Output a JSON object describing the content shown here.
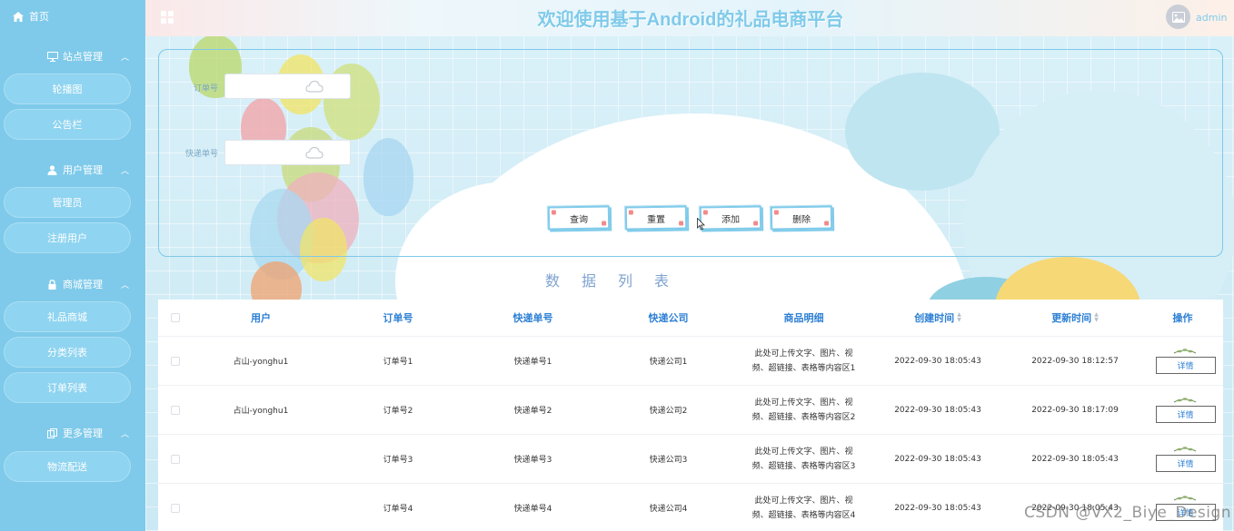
{
  "header": {
    "title": "欢迎使用基于Android的礼品电商平台",
    "user": "admin"
  },
  "sidebar": {
    "home": "首页",
    "groups": [
      {
        "label": "站点管理",
        "icon": "monitor-icon",
        "items": [
          "轮播图",
          "公告栏"
        ]
      },
      {
        "label": "用户管理",
        "icon": "user-icon",
        "items": [
          "管理员",
          "注册用户"
        ]
      },
      {
        "label": "商城管理",
        "icon": "lock-icon",
        "items": [
          "礼品商城",
          "分类列表",
          "订单列表"
        ]
      },
      {
        "label": "更多管理",
        "icon": "copy-icon",
        "items": [
          "物流配送"
        ]
      }
    ]
  },
  "search": {
    "order_label": "订单号",
    "express_label": "快递单号",
    "order_value": "",
    "express_value": "",
    "buttons": {
      "query": "查询",
      "reset": "重置",
      "add": "添加",
      "delete": "删除"
    }
  },
  "table": {
    "title": "数据列表",
    "columns": [
      "用户",
      "订单号",
      "快递单号",
      "快递公司",
      "商品明细",
      "创建时间",
      "更新时间",
      "操作"
    ],
    "detail_label": "详情",
    "rows": [
      {
        "user": "占山-yonghu1",
        "order": "订单号1",
        "express_no": "快递单号1",
        "company": "快递公司1",
        "detail_line1": "此处可上传文字、图片、视",
        "detail_line2": "频、超链接、表格等内容区1",
        "created": "2022-09-30 18:05:43",
        "updated": "2022-09-30 18:12:57"
      },
      {
        "user": "占山-yonghu1",
        "order": "订单号2",
        "express_no": "快递单号2",
        "company": "快递公司2",
        "detail_line1": "此处可上传文字、图片、视",
        "detail_line2": "频、超链接、表格等内容区2",
        "created": "2022-09-30 18:05:43",
        "updated": "2022-09-30 18:17:09"
      },
      {
        "user": "",
        "order": "订单号3",
        "express_no": "快递单号3",
        "company": "快递公司3",
        "detail_line1": "此处可上传文字、图片、视",
        "detail_line2": "频、超链接、表格等内容区3",
        "created": "2022-09-30 18:05:43",
        "updated": "2022-09-30 18:05:43"
      },
      {
        "user": "",
        "order": "订单号4",
        "express_no": "快递单号4",
        "company": "快递公司4",
        "detail_line1": "此处可上传文字、图片、视",
        "detail_line2": "频、超链接、表格等内容区4",
        "created": "2022-09-30 18:05:43",
        "updated": "2022-09-30 18:05:43"
      }
    ]
  },
  "watermark": "CSDN @VX2_Biye_Design",
  "colors": {
    "accent": "#7fcaea",
    "header_text": "#2c7fd4",
    "sidebar_bg": "#7fcaea"
  }
}
